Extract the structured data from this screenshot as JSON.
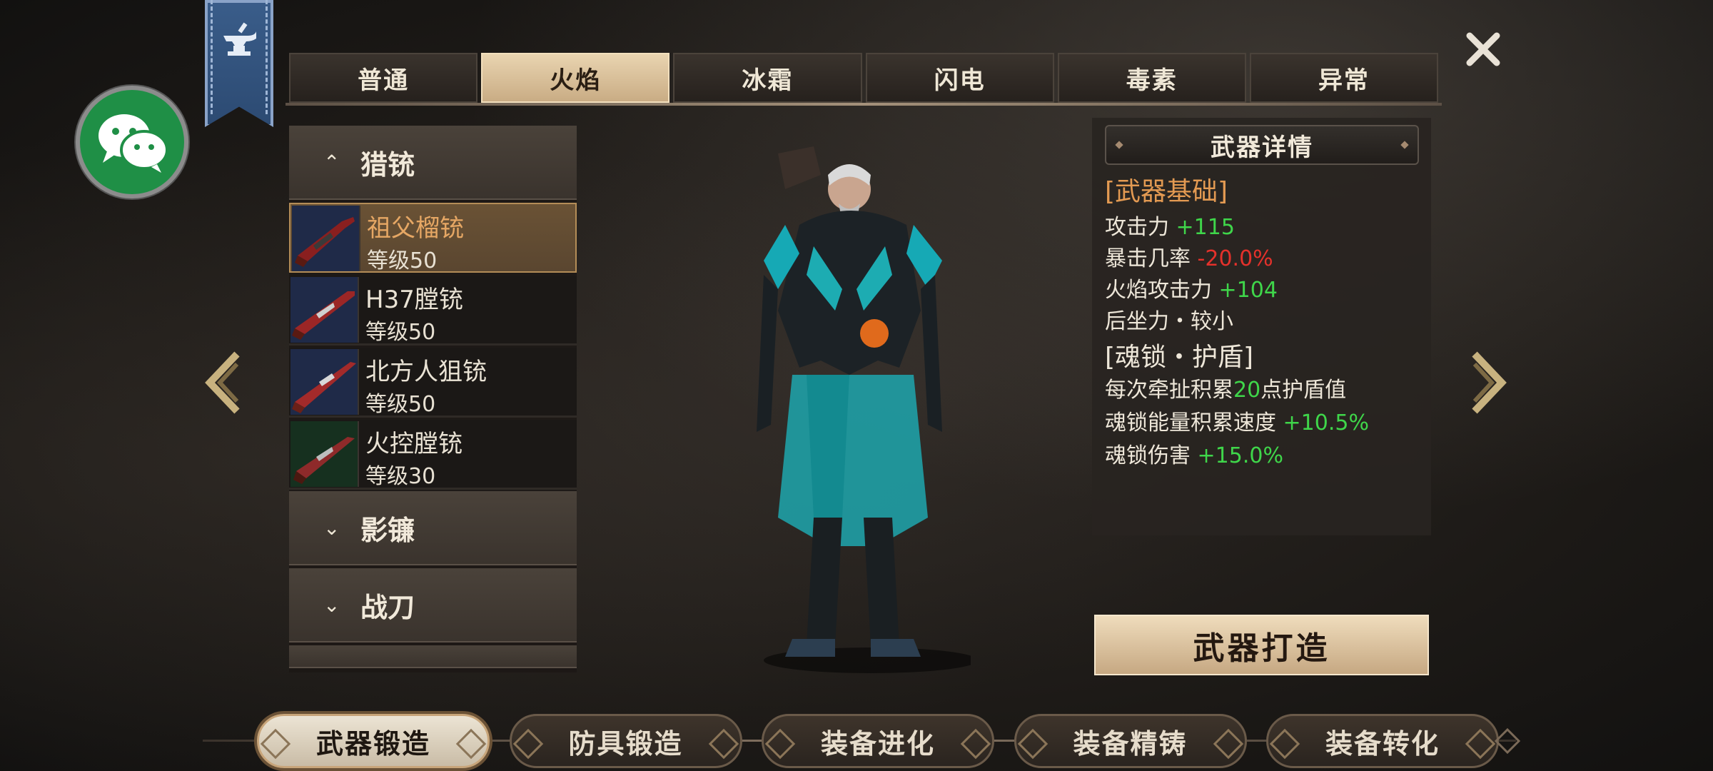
{
  "top_tabs": [
    {
      "label": "普通",
      "active": false
    },
    {
      "label": "火焰",
      "active": true
    },
    {
      "label": "冰霜",
      "active": false
    },
    {
      "label": "闪电",
      "active": false
    },
    {
      "label": "毒素",
      "active": false
    },
    {
      "label": "异常",
      "active": false
    }
  ],
  "weapon_list": {
    "categories": [
      {
        "label": "猎铳",
        "expanded": true
      },
      {
        "label": "影镰",
        "expanded": false
      },
      {
        "label": "战刀",
        "expanded": false
      }
    ],
    "items": [
      {
        "name": "祖父榴铳",
        "level": "等级50",
        "selected": true
      },
      {
        "name": "H37膛铳",
        "level": "等级50",
        "selected": false
      },
      {
        "name": "北方人狙铳",
        "level": "等级50",
        "selected": false
      },
      {
        "name": "火控膛铳",
        "level": "等级30",
        "selected": false
      }
    ]
  },
  "details": {
    "title": "武器详情",
    "basic_section": "[武器基础]",
    "attack_label": "攻击力",
    "attack_value": "+115",
    "crit_label": "暴击几率",
    "crit_value": "-20.0%",
    "fire_label": "火焰攻击力",
    "fire_value": "+104",
    "recoil": "后坐力・较小",
    "soul_section": "[魂锁・护盾]",
    "shield_prefix": "每次牵扯积累",
    "shield_value": "20",
    "shield_suffix": "点护盾值",
    "energy_label": "魂锁能量积累速度",
    "energy_value": "+10.5%",
    "damage_label": "魂锁伤害",
    "damage_value": "+15.0%"
  },
  "forge_button": "武器打造",
  "bottom_nav": [
    {
      "label": "武器锻造",
      "active": true
    },
    {
      "label": "防具锻造",
      "active": false
    },
    {
      "label": "装备进化",
      "active": false
    },
    {
      "label": "装备精铸",
      "active": false
    },
    {
      "label": "装备转化",
      "active": false
    }
  ],
  "icons": {
    "banner": "anvil-icon",
    "social": "wechat-icon",
    "close": "close-icon",
    "prev": "chevron-left-icon",
    "next": "chevron-right-icon"
  },
  "colors": {
    "positive": "#3fd64a",
    "negative": "#e4312b",
    "highlight": "#e39a52",
    "active_tab": "#c9ac84"
  }
}
